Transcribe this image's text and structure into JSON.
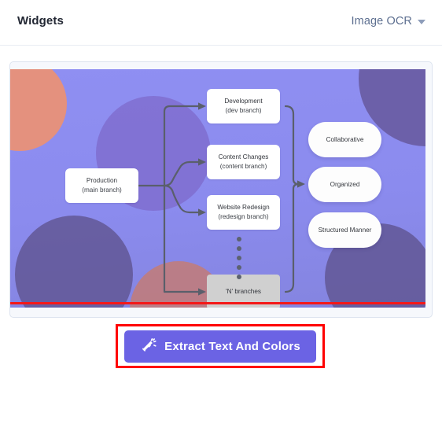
{
  "header": {
    "title": "Widgets",
    "mode_label": "Image OCR",
    "caret_icon": "chevron-down-icon"
  },
  "image_card": {
    "alt_description": "Git branching diagram on purple background",
    "background_color": "#8b8bee",
    "decorations": [
      {
        "name": "circle-orange-top-left",
        "color": "#e4917e"
      },
      {
        "name": "circle-purple-top-center",
        "color": "#7a63c4"
      },
      {
        "name": "circle-purple-top-right",
        "color": "#5f4f8e"
      },
      {
        "name": "circle-purple-bottom-left",
        "color": "#5f5490"
      },
      {
        "name": "circle-orange-bottom-center",
        "color": "#cf7a62"
      },
      {
        "name": "circle-purple-bottom-right",
        "color": "#5f5490"
      }
    ],
    "nodes": {
      "production": {
        "line1": "Production",
        "line2": "(main branch)"
      },
      "development": {
        "line1": "Development",
        "line2": "(dev branch)"
      },
      "content": {
        "line1": "Content Changes",
        "line2": "(content branch)"
      },
      "redesign": {
        "line1": "Website Redesign",
        "line2": "(redesign branch)"
      },
      "n_branches": {
        "line1": "'N' branches"
      }
    },
    "pills": [
      {
        "label": "Collaborative"
      },
      {
        "label": "Organized"
      },
      {
        "label": "Structured Manner"
      }
    ],
    "ellipsis_dot_count": 5,
    "annotation_line_color": "#f41818"
  },
  "cta": {
    "label": "Extract Text And Colors",
    "icon": "magic-wand-icon",
    "button_color": "#6b63e4",
    "highlight_color": "#ff0000"
  }
}
